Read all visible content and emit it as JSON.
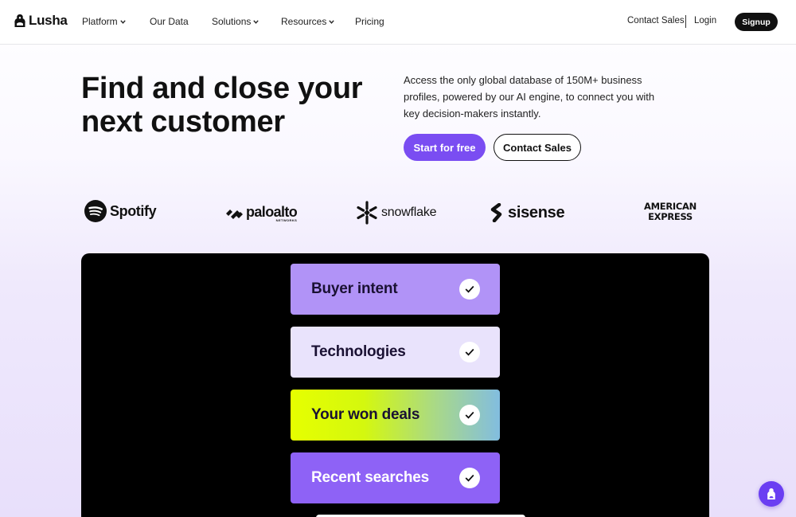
{
  "nav": {
    "logo_text": "Lusha",
    "items": [
      {
        "label": "Platform",
        "has_dropdown": true
      },
      {
        "label": "Our Data",
        "has_dropdown": false
      },
      {
        "label": "Solutions",
        "has_dropdown": true
      },
      {
        "label": "Resources",
        "has_dropdown": true
      },
      {
        "label": "Pricing",
        "has_dropdown": false
      }
    ],
    "contact_sales": "Contact Sales",
    "login": "Login",
    "signup": "Signup"
  },
  "hero": {
    "headline": "Find and close your next customer",
    "description": "Access the only global database of 150M+ business profiles, powered by our AI engine, to connect you with key decision-makers instantly.",
    "primary_cta": "Start for free",
    "secondary_cta": "Contact Sales"
  },
  "logos": {
    "spotify": "Spotify",
    "paloalto": "paloalto",
    "paloalto_sub": "NETWORKS",
    "snowflake": "snowflake",
    "sisense": "sisense",
    "amex_line1": "AMERICAN",
    "amex_line2": "EXPRESS"
  },
  "panel": {
    "cards": [
      {
        "label": "Buyer intent",
        "checked": true
      },
      {
        "label": "Technologies",
        "checked": true
      },
      {
        "label": "Your won deals",
        "checked": true
      },
      {
        "label": "Recent searches",
        "checked": true
      }
    ]
  },
  "colors": {
    "accent": "#7a4df2",
    "dark": "#111111",
    "card_buyer_intent": "#b193f7",
    "card_technologies": "#e9e3fc",
    "card_recent_searches": "#8e62f6"
  },
  "icons": [
    "lusha-logo-icon",
    "chevron-down-icon",
    "check-icon",
    "chat-launcher-icon"
  ]
}
